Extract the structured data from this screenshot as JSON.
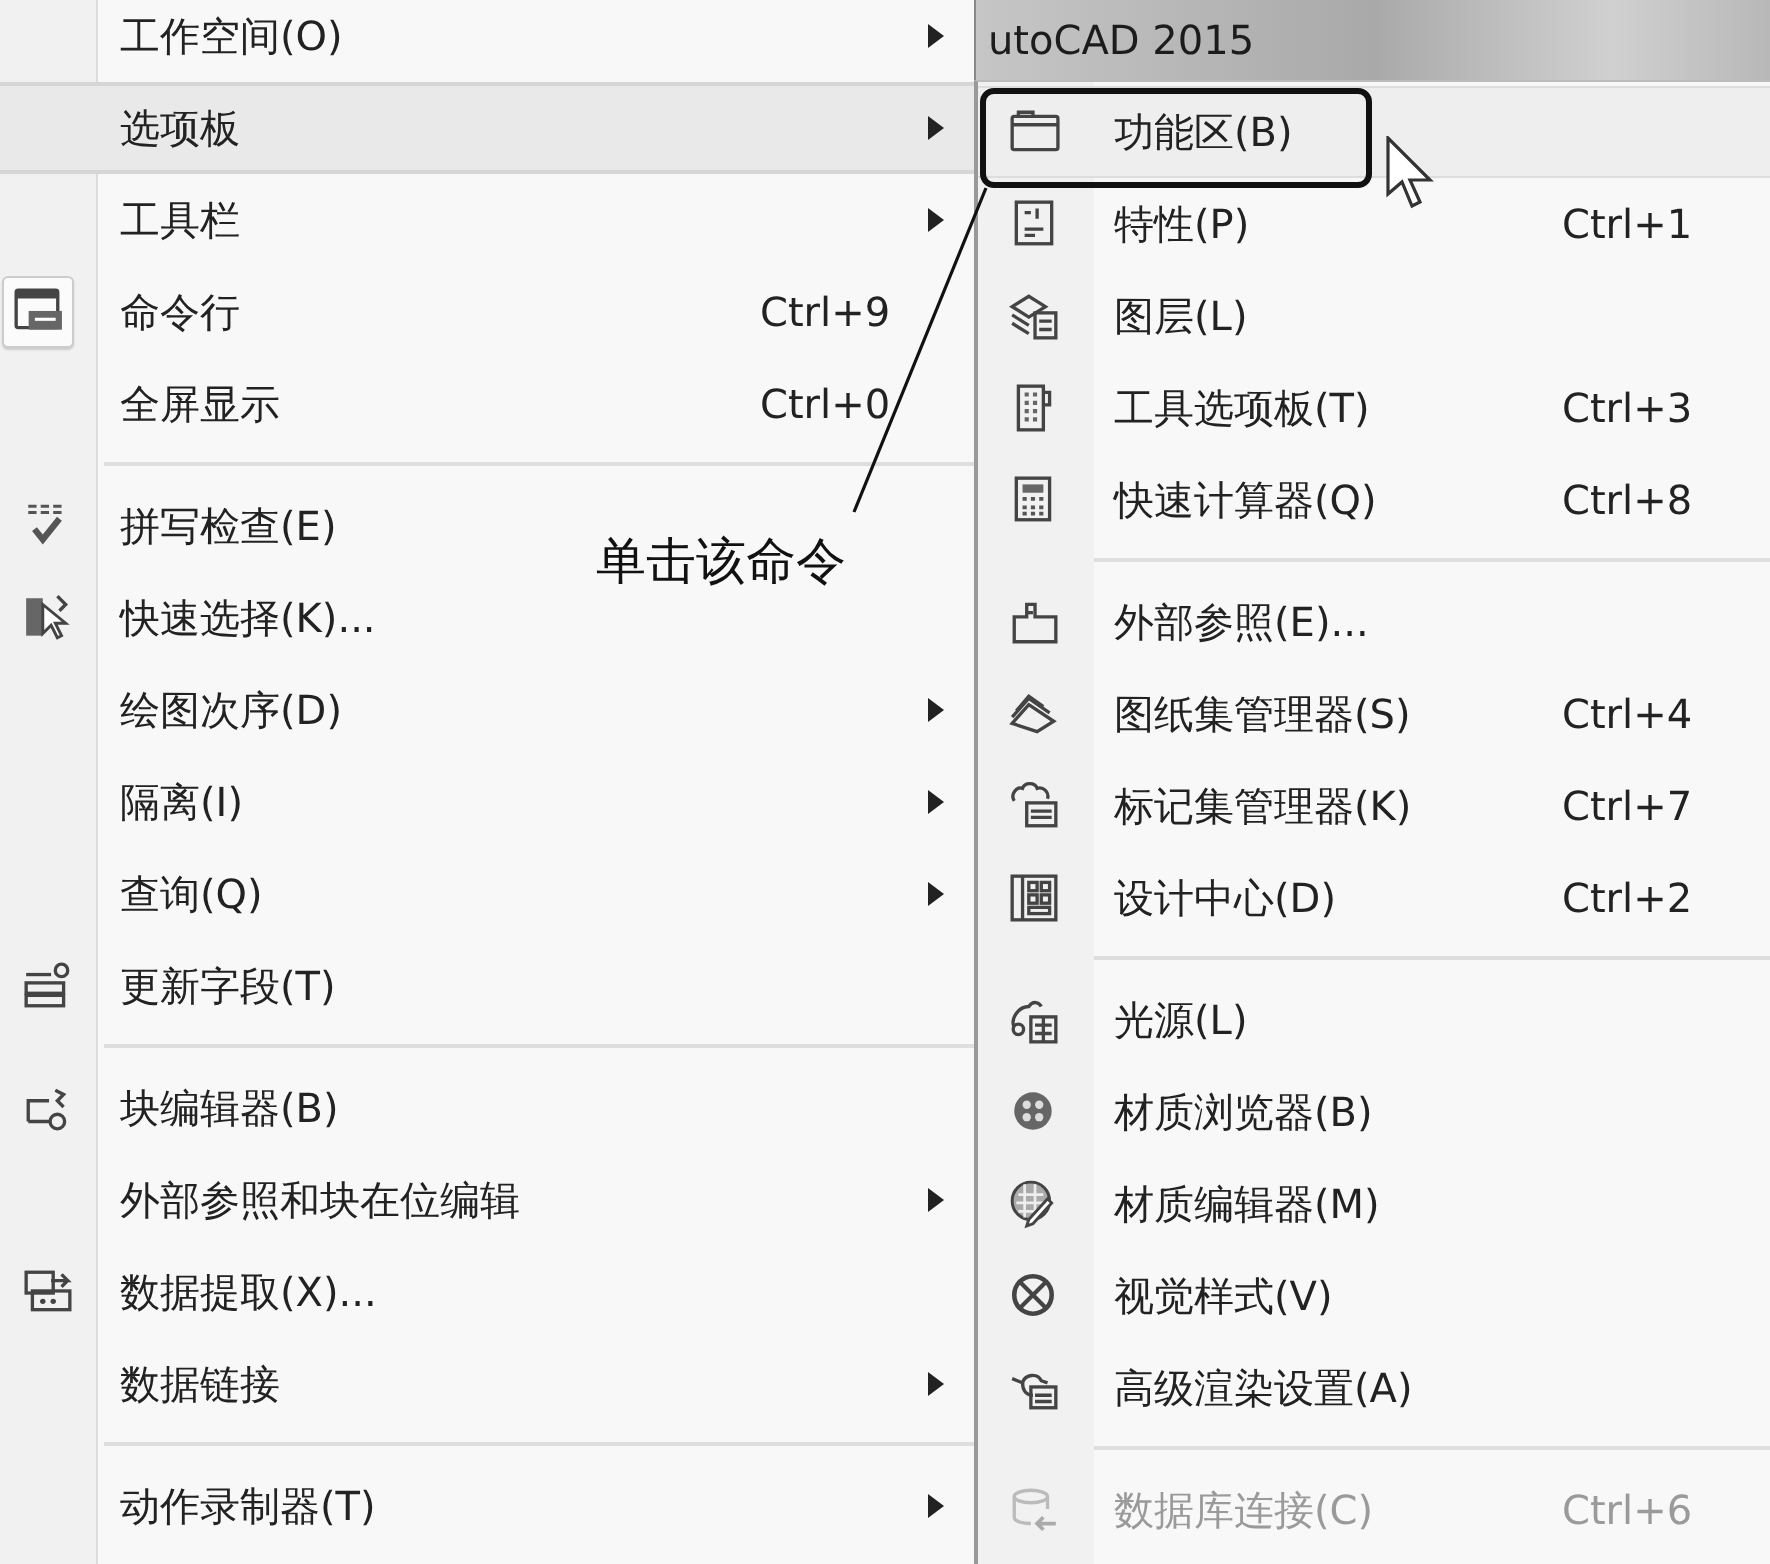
{
  "title_bar": {
    "text": "utoCAD 2015"
  },
  "menu": {
    "items": [
      {
        "kind": "item",
        "label": "工作空间(O)",
        "submenu": true,
        "selected": false
      },
      {
        "kind": "item",
        "label": "选项板",
        "submenu": true,
        "selected": true
      },
      {
        "kind": "item",
        "label": "工具栏",
        "submenu": true,
        "selected": false
      },
      {
        "kind": "item",
        "label": "命令行",
        "shortcut": "Ctrl+9",
        "submenu": false,
        "selected": false
      },
      {
        "kind": "item",
        "label": "全屏显示",
        "shortcut": "Ctrl+0",
        "submenu": false,
        "selected": false
      },
      {
        "kind": "separator"
      },
      {
        "kind": "item",
        "label": "拼写检查(E)",
        "submenu": false,
        "selected": false
      },
      {
        "kind": "item",
        "label": "快速选择(K)...",
        "submenu": false,
        "selected": false
      },
      {
        "kind": "item",
        "label": "绘图次序(D)",
        "submenu": true,
        "selected": false
      },
      {
        "kind": "item",
        "label": "隔离(I)",
        "submenu": true,
        "selected": false
      },
      {
        "kind": "item",
        "label": "查询(Q)",
        "submenu": true,
        "selected": false
      },
      {
        "kind": "item",
        "label": "更新字段(T)",
        "submenu": false,
        "selected": false
      },
      {
        "kind": "separator"
      },
      {
        "kind": "item",
        "label": "块编辑器(B)",
        "submenu": false,
        "selected": false
      },
      {
        "kind": "item",
        "label": "外部参照和块在位编辑",
        "submenu": true,
        "selected": false
      },
      {
        "kind": "item",
        "label": "数据提取(X)...",
        "submenu": false,
        "selected": false
      },
      {
        "kind": "item",
        "label": "数据链接",
        "submenu": true,
        "selected": false
      },
      {
        "kind": "separator"
      },
      {
        "kind": "item",
        "label": "动作录制器(T)",
        "submenu": true,
        "selected": false
      }
    ]
  },
  "submenu": {
    "items": [
      {
        "kind": "item",
        "label": "功能区(B)",
        "selected": true,
        "disabled": false
      },
      {
        "kind": "item",
        "label": "特性(P)",
        "shortcut": "Ctrl+1",
        "selected": false,
        "disabled": false
      },
      {
        "kind": "item",
        "label": "图层(L)",
        "selected": false,
        "disabled": false
      },
      {
        "kind": "item",
        "label": "工具选项板(T)",
        "shortcut": "Ctrl+3",
        "selected": false,
        "disabled": false
      },
      {
        "kind": "item",
        "label": "快速计算器(Q)",
        "shortcut": "Ctrl+8",
        "selected": false,
        "disabled": false
      },
      {
        "kind": "separator"
      },
      {
        "kind": "item",
        "label": "外部参照(E)...",
        "selected": false,
        "disabled": false
      },
      {
        "kind": "item",
        "label": "图纸集管理器(S)",
        "shortcut": "Ctrl+4",
        "selected": false,
        "disabled": false
      },
      {
        "kind": "item",
        "label": "标记集管理器(K)",
        "shortcut": "Ctrl+7",
        "selected": false,
        "disabled": false
      },
      {
        "kind": "item",
        "label": "设计中心(D)",
        "shortcut": "Ctrl+2",
        "selected": false,
        "disabled": false
      },
      {
        "kind": "separator"
      },
      {
        "kind": "item",
        "label": "光源(L)",
        "selected": false,
        "disabled": false
      },
      {
        "kind": "item",
        "label": "材质浏览器(B)",
        "selected": false,
        "disabled": false
      },
      {
        "kind": "item",
        "label": "材质编辑器(M)",
        "selected": false,
        "disabled": false
      },
      {
        "kind": "item",
        "label": "视觉样式(V)",
        "selected": false,
        "disabled": false
      },
      {
        "kind": "item",
        "label": "高级渲染设置(A)",
        "selected": false,
        "disabled": false
      },
      {
        "kind": "separator"
      },
      {
        "kind": "item",
        "label": "数据库连接(C)",
        "shortcut": "Ctrl+6",
        "selected": false,
        "disabled": true
      }
    ]
  },
  "annotation": {
    "text": "单击该命令"
  }
}
